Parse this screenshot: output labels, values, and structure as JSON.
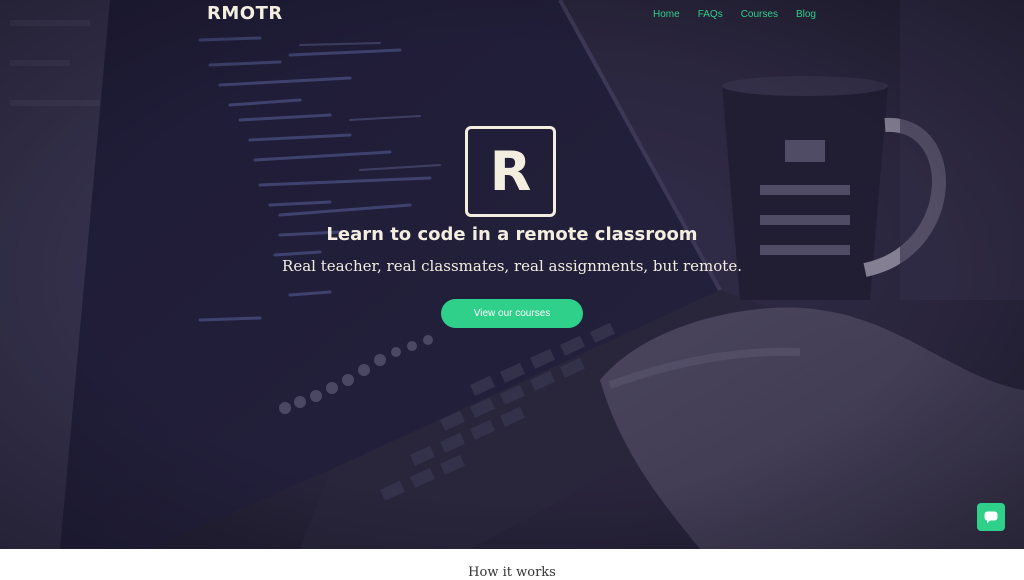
{
  "header": {
    "logo": "RMOTR",
    "nav": [
      "Home",
      "FAQs",
      "Courses",
      "Blog"
    ]
  },
  "hero": {
    "logo_letter": "R",
    "title": "Learn to code in a remote classroom",
    "subtitle": "Real teacher, real classmates, real assignments, but remote.",
    "cta_label": "View our courses"
  },
  "chat": {
    "icon": "chat-bubble-icon"
  },
  "below_fold": {
    "heading": "How it works"
  },
  "colors": {
    "accent": "#2fd08a",
    "hero_text": "#f3eee0",
    "hero_tint": "#2a2638"
  }
}
